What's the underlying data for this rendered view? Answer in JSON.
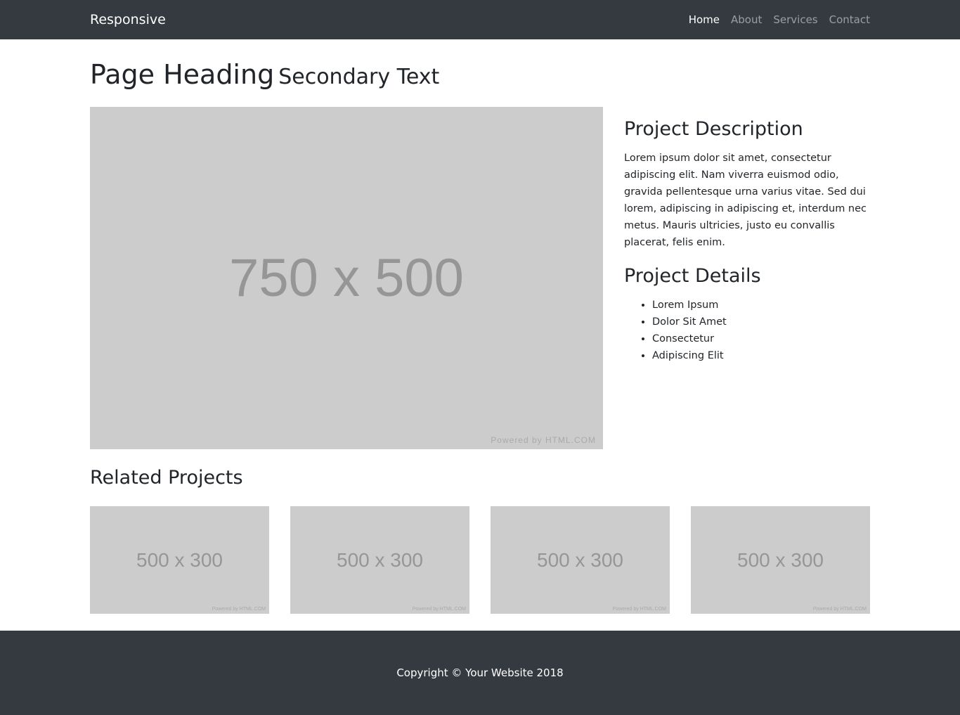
{
  "nav": {
    "brand": "Responsive",
    "links": [
      "Home",
      "About",
      "Services",
      "Contact"
    ]
  },
  "heading": {
    "title": "Page Heading",
    "secondary": "Secondary Text"
  },
  "main_image": {
    "label": "750 x 500",
    "powered": "Powered by HTML.COM"
  },
  "description": {
    "title": "Project Description",
    "text": "Lorem ipsum dolor sit amet, consectetur adipiscing elit. Nam viverra euismod odio, gravida pellentesque urna varius vitae. Sed dui lorem, adipiscing in adipiscing et, interdum nec metus. Mauris ultricies, justo eu convallis placerat, felis enim."
  },
  "details": {
    "title": "Project Details",
    "items": [
      "Lorem Ipsum",
      "Dolor Sit Amet",
      "Consectetur",
      "Adipiscing Elit"
    ]
  },
  "related": {
    "title": "Related Projects",
    "items": [
      {
        "label": "500 x 300",
        "powered": "Powered by HTML.COM"
      },
      {
        "label": "500 x 300",
        "powered": "Powered by HTML.COM"
      },
      {
        "label": "500 x 300",
        "powered": "Powered by HTML.COM"
      },
      {
        "label": "500 x 300",
        "powered": "Powered by HTML.COM"
      }
    ]
  },
  "footer": {
    "text": "Copyright © Your Website 2018"
  }
}
